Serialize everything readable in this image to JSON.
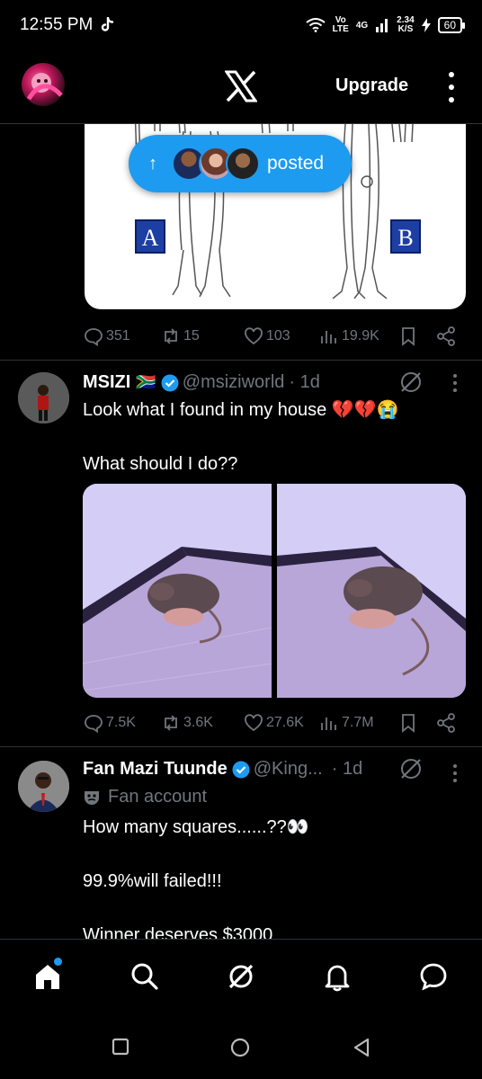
{
  "status_bar": {
    "time": "12:55 PM",
    "network_top": "Vo",
    "network_bottom": "LTE",
    "network_type": "4G",
    "speed_top": "2.34",
    "speed_bottom": "K/S",
    "battery": "60"
  },
  "header": {
    "upgrade_label": "Upgrade"
  },
  "posted_pill": {
    "label": "posted"
  },
  "tweet1": {
    "image_labels": [
      "A",
      "B"
    ],
    "stats": {
      "replies": "351",
      "reposts": "15",
      "likes": "103",
      "views": "19.9K"
    }
  },
  "tweet2": {
    "name": "MSIZI",
    "flag": "🇿🇦",
    "handle": "@msiziworld",
    "time": "· 1d",
    "text_line1": "Look what I found in my house 💔💔😭",
    "text_line2": "What should I do??",
    "stats": {
      "replies": "7.5K",
      "reposts": "3.6K",
      "likes": "27.6K",
      "views": "7.7M"
    }
  },
  "tweet3": {
    "name": "Fan Mazi Tuunde",
    "handle": "@King...",
    "time": "· 1d",
    "badge_label": "Fan account",
    "text_line1": "How many squares......??👀",
    "text_line2": "99.9%will failed!!!",
    "text_line3": "Winner deserves $3000"
  },
  "colors": {
    "accent": "#1d9bf0",
    "muted": "#71767b",
    "background": "#000000",
    "divider": "#2f3336"
  },
  "icons": [
    "x-logo",
    "reply-icon",
    "repost-icon",
    "like-icon",
    "views-icon",
    "bookmark-icon",
    "share-icon",
    "grok-icon",
    "home-icon",
    "search-icon",
    "notifications-icon",
    "messages-icon"
  ]
}
